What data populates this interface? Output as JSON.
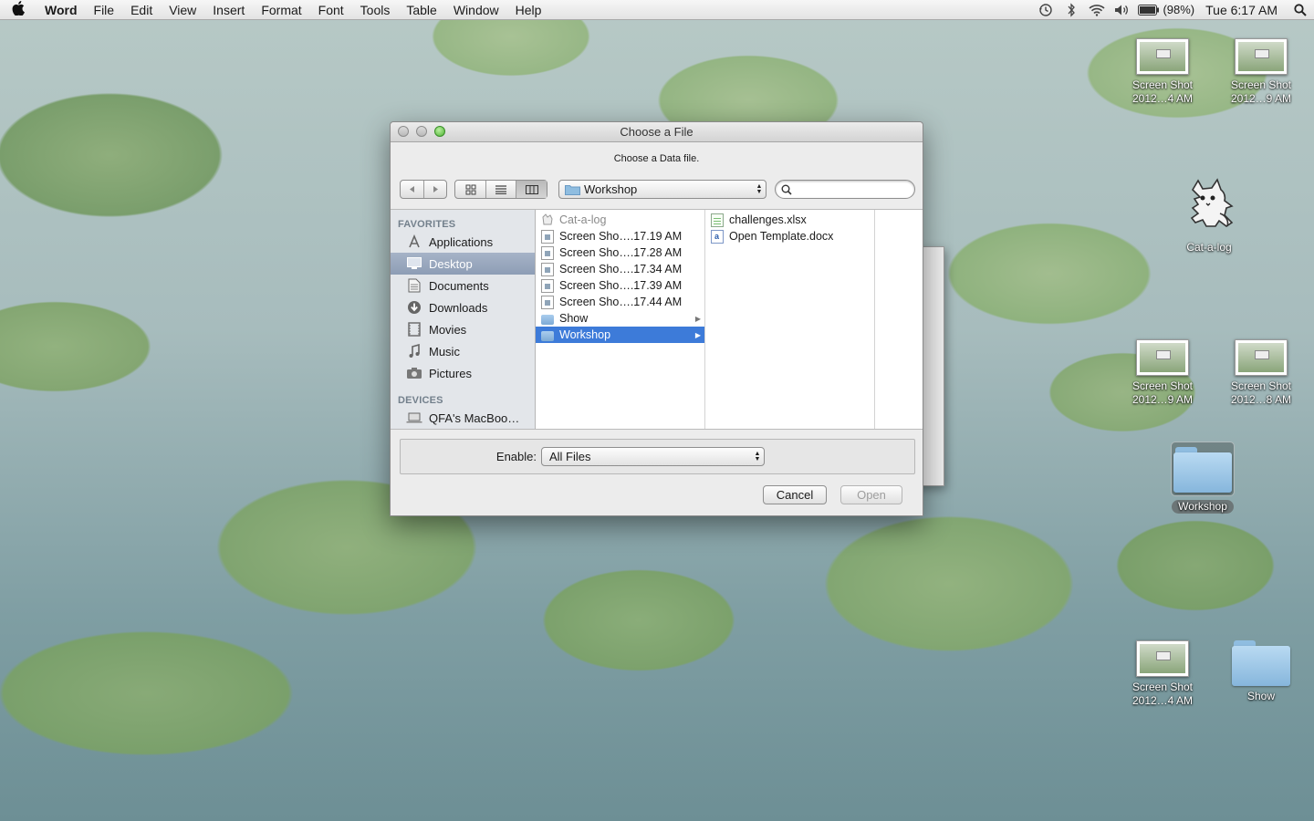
{
  "menubar": {
    "app_name": "Word",
    "menus": [
      "File",
      "Edit",
      "View",
      "Insert",
      "Format",
      "Font",
      "Tools",
      "Table",
      "Window",
      "Help"
    ],
    "battery_percent": "(98%)",
    "clock": "Tue 6:17 AM"
  },
  "desktop": {
    "icons": {
      "shot1": {
        "line1": "Screen Shot",
        "line2": "2012…4 AM"
      },
      "shot2": {
        "line1": "Screen Shot",
        "line2": "2012…9 AM"
      },
      "catalog": {
        "label": "Cat-a-log"
      },
      "shot3": {
        "line1": "Screen Shot",
        "line2": "2012…9 AM"
      },
      "shot4": {
        "line1": "Screen Shot",
        "line2": "2012…8 AM"
      },
      "workshop": {
        "label": "Workshop"
      },
      "shot5": {
        "line1": "Screen Shot",
        "line2": "2012…4 AM"
      },
      "show": {
        "label": "Show"
      }
    }
  },
  "dialog": {
    "title": "Choose a File",
    "prompt": "Choose a Data file.",
    "location": "Workshop",
    "search_placeholder": "",
    "sidebar": {
      "favorites_header": "FAVORITES",
      "favorites": [
        {
          "label": "Applications",
          "icon": "applications-icon",
          "selected": false
        },
        {
          "label": "Desktop",
          "icon": "desktop-icon",
          "selected": true
        },
        {
          "label": "Documents",
          "icon": "documents-icon",
          "selected": false
        },
        {
          "label": "Downloads",
          "icon": "downloads-icon",
          "selected": false
        },
        {
          "label": "Movies",
          "icon": "movies-icon",
          "selected": false
        },
        {
          "label": "Music",
          "icon": "music-icon",
          "selected": false
        },
        {
          "label": "Pictures",
          "icon": "pictures-icon",
          "selected": false
        }
      ],
      "devices_header": "DEVICES",
      "devices": [
        {
          "label": "QFA's MacBoo…",
          "icon": "laptop-icon"
        }
      ]
    },
    "column1": [
      {
        "name": "Cat-a-log",
        "kind": "app",
        "dim": true
      },
      {
        "name": "Screen Sho….17.19 AM",
        "kind": "image"
      },
      {
        "name": "Screen Sho….17.28 AM",
        "kind": "image"
      },
      {
        "name": "Screen Sho….17.34 AM",
        "kind": "image"
      },
      {
        "name": "Screen Sho….17.39 AM",
        "kind": "image"
      },
      {
        "name": "Screen Sho….17.44 AM",
        "kind": "image"
      },
      {
        "name": "Show",
        "kind": "folder"
      },
      {
        "name": "Workshop",
        "kind": "folder",
        "selected": true
      }
    ],
    "column2": [
      {
        "name": "challenges.xlsx",
        "kind": "xlsx"
      },
      {
        "name": "Open Template.docx",
        "kind": "docx"
      }
    ],
    "enable_label": "Enable:",
    "enable_value": "All Files",
    "cancel_label": "Cancel",
    "open_label": "Open"
  },
  "colors": {
    "selection_blue": "#3d7bd9",
    "sidebar_selection": "#8d9db5",
    "zoom_green": "#4fb232"
  }
}
